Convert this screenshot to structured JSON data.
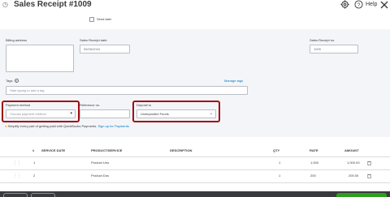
{
  "header": {
    "title": "Sales Receipt #1009",
    "help_label": "Help"
  },
  "send_later": {
    "label": "Send later",
    "checked": false
  },
  "billing": {
    "label": "Billing address",
    "value": ""
  },
  "sales_receipt_date": {
    "label": "Sales Receipt date",
    "value": "05/26/2024"
  },
  "sales_receipt_no": {
    "label": "Sales Receipt no.",
    "value": "1009"
  },
  "tags": {
    "label": "Tags",
    "placeholder": "Start typing to add a tag",
    "manage_link": "Manage tags"
  },
  "payment_method": {
    "label": "Payment method",
    "placeholder": "Choose payment method"
  },
  "reference_no": {
    "label": "Reference no.",
    "value": ""
  },
  "deposit_to": {
    "label": "Deposit to",
    "value": "Undeposited Funds"
  },
  "promo": {
    "text": "Simplify every part of getting paid with QuickBooks Payments.",
    "link": "Sign up for Payments"
  },
  "table": {
    "columns": [
      "#",
      "SERVICE DATE",
      "PRODUCT/SERVICE",
      "DESCRIPTION",
      "QTY",
      "RATE",
      "AMOUNT"
    ],
    "rows": [
      {
        "num": "1",
        "service_date": "",
        "product": "Product Uno",
        "description": "",
        "qty": "1",
        "rate": "1,000",
        "amount": "1,000.00"
      },
      {
        "num": "2",
        "service_date": "",
        "product": "Product Dos",
        "description": "",
        "qty": "1",
        "rate": "200",
        "amount": "200.00"
      }
    ]
  },
  "colors": {
    "accent_link": "#0077c5",
    "highlight_border": "#a10f14",
    "panel_bg": "#f4f5f8",
    "footer_bg": "#393a3d",
    "primary_green": "#2ca01c"
  }
}
